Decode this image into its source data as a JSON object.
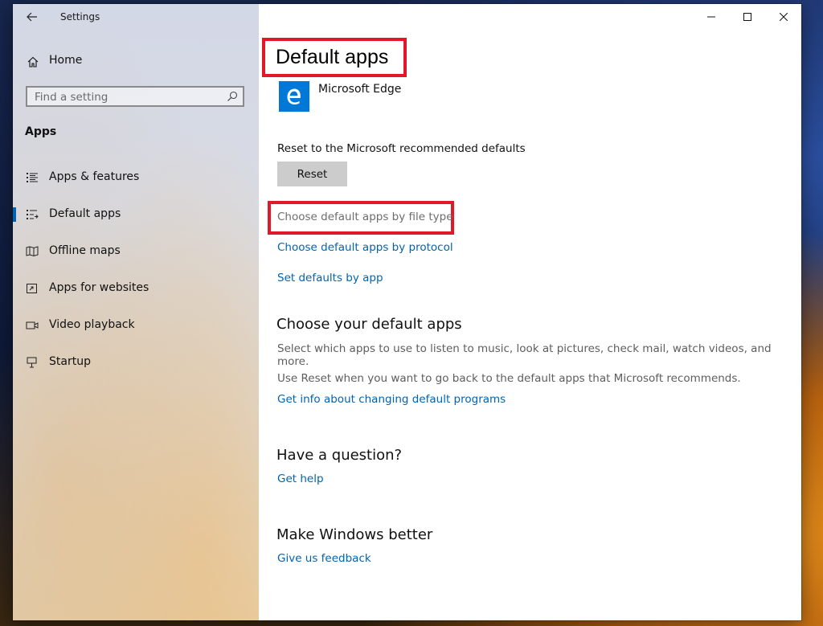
{
  "window": {
    "app_title": "Settings"
  },
  "sidebar": {
    "home_label": "Home",
    "search": {
      "placeholder": "Find a setting"
    },
    "section_label": "Apps",
    "items": [
      {
        "label": "Apps & features",
        "icon": "apps-features-icon"
      },
      {
        "label": "Default apps",
        "icon": "default-apps-icon",
        "selected": true
      },
      {
        "label": "Offline maps",
        "icon": "map-icon"
      },
      {
        "label": "Apps for websites",
        "icon": "open-in-app-icon"
      },
      {
        "label": "Video playback",
        "icon": "video-icon"
      },
      {
        "label": "Startup",
        "icon": "startup-icon"
      }
    ],
    "accent_color": "#0063b1"
  },
  "main": {
    "title": "Default apps",
    "current_app": "Microsoft Edge",
    "reset_text": "Reset to the Microsoft recommended defaults",
    "reset_button": "Reset",
    "links": {
      "by_file_type": "Choose default apps by file type",
      "by_protocol": "Choose default apps by protocol",
      "by_app": "Set defaults by app"
    },
    "choose_section": {
      "heading": "Choose your default apps",
      "description": "Select which apps to use to listen to music, look at pictures, check mail, watch videos, and more.",
      "reset_note": "Use Reset when you want to go back to the default apps that Microsoft recommends.",
      "info_link": "Get info about changing default programs"
    },
    "question_section": {
      "heading": "Have a question?",
      "link": "Get help"
    },
    "better_section": {
      "heading": "Make Windows better",
      "link": "Give us feedback"
    },
    "highlight_color": "#e01828",
    "link_color": "#0063b1"
  }
}
